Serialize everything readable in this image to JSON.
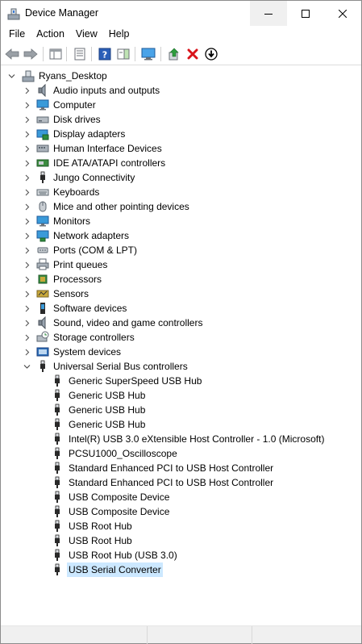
{
  "window": {
    "title": "Device Manager"
  },
  "menu": [
    "File",
    "Action",
    "View",
    "Help"
  ],
  "tree": {
    "root": "Ryans_Desktop",
    "categories": [
      {
        "label": "Audio inputs and outputs",
        "icon": "speaker-icon"
      },
      {
        "label": "Computer",
        "icon": "monitor-icon"
      },
      {
        "label": "Disk drives",
        "icon": "disk-drive-icon"
      },
      {
        "label": "Display adapters",
        "icon": "display-adapter-icon"
      },
      {
        "label": "Human Interface Devices",
        "icon": "hid-icon"
      },
      {
        "label": "IDE ATA/ATAPI controllers",
        "icon": "ide-controller-icon"
      },
      {
        "label": "Jungo Connectivity",
        "icon": "usb-plug-icon"
      },
      {
        "label": "Keyboards",
        "icon": "keyboard-icon"
      },
      {
        "label": "Mice and other pointing devices",
        "icon": "mouse-icon"
      },
      {
        "label": "Monitors",
        "icon": "monitor-icon"
      },
      {
        "label": "Network adapters",
        "icon": "network-adapter-icon"
      },
      {
        "label": "Ports (COM & LPT)",
        "icon": "port-icon"
      },
      {
        "label": "Print queues",
        "icon": "printer-icon"
      },
      {
        "label": "Processors",
        "icon": "processor-icon"
      },
      {
        "label": "Sensors",
        "icon": "sensor-icon"
      },
      {
        "label": "Software devices",
        "icon": "software-device-icon"
      },
      {
        "label": "Sound, video and game controllers",
        "icon": "speaker-icon"
      },
      {
        "label": "Storage controllers",
        "icon": "storage-controller-icon"
      },
      {
        "label": "System devices",
        "icon": "system-device-icon"
      },
      {
        "label": "Universal Serial Bus controllers",
        "icon": "usb-plug-icon",
        "expanded": true
      }
    ],
    "usb_children": [
      "Generic SuperSpeed USB Hub",
      "Generic USB Hub",
      "Generic USB Hub",
      "Generic USB Hub",
      "Intel(R) USB 3.0 eXtensible Host Controller - 1.0 (Microsoft)",
      "PCSU1000_Oscilloscope",
      "Standard Enhanced PCI to USB Host Controller",
      "Standard Enhanced PCI to USB Host Controller",
      "USB Composite Device",
      "USB Composite Device",
      "USB Root Hub",
      "USB Root Hub",
      "USB Root Hub (USB 3.0)",
      "USB Serial Converter"
    ],
    "selected": "USB Serial Converter"
  },
  "colors": {
    "selection": "#cce8ff",
    "accent_blue": "#1e6fc9",
    "delete_red": "#d9141b"
  }
}
